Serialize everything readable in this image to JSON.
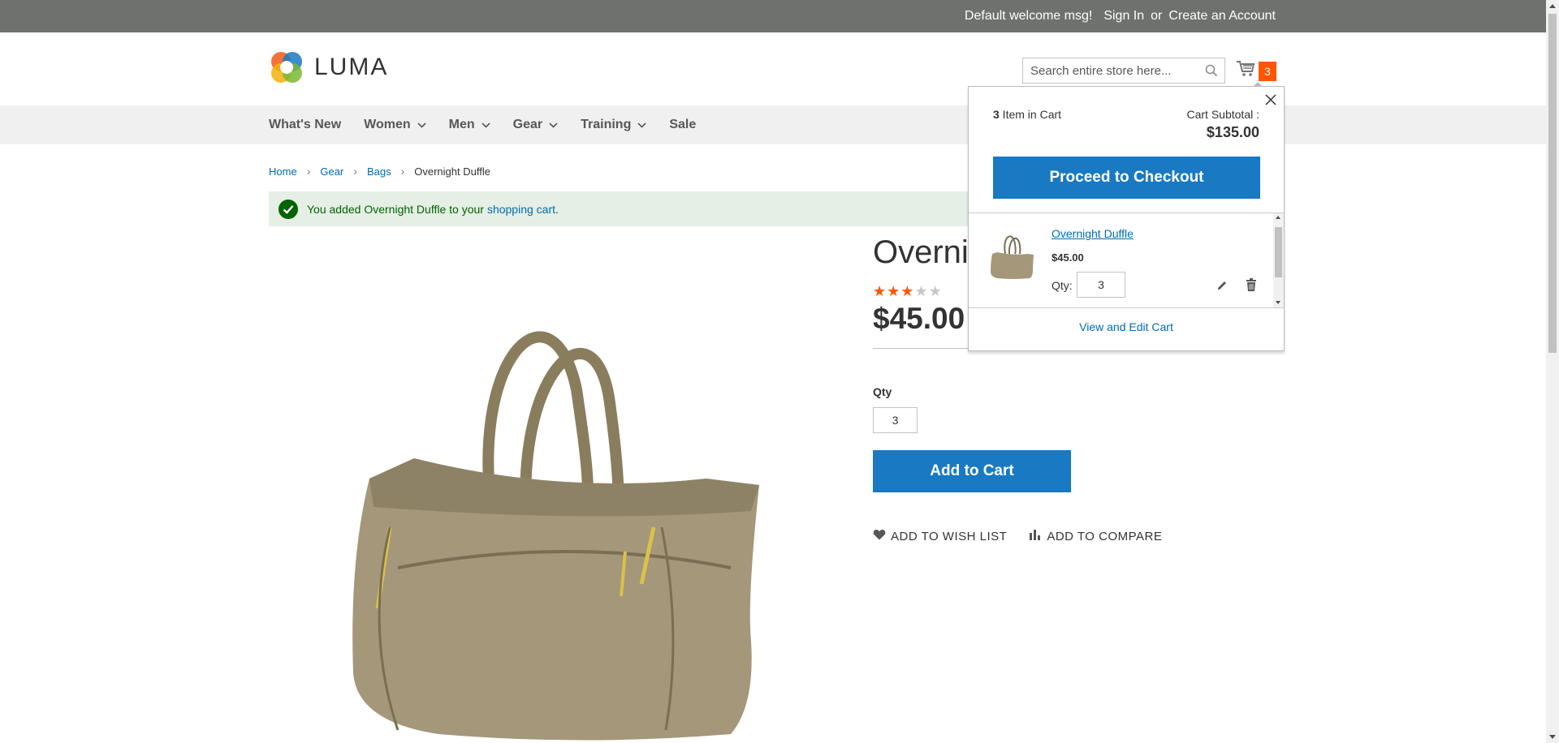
{
  "topbar": {
    "welcome": "Default welcome msg!",
    "sign_in": "Sign In",
    "or": "or",
    "create_account": "Create an Account"
  },
  "header": {
    "logo_text": "LUMA",
    "search_placeholder": "Search entire store here...",
    "cart_count": "3"
  },
  "nav": {
    "items": [
      {
        "label": "What's New",
        "has_dropdown": false
      },
      {
        "label": "Women",
        "has_dropdown": true
      },
      {
        "label": "Men",
        "has_dropdown": true
      },
      {
        "label": "Gear",
        "has_dropdown": true
      },
      {
        "label": "Training",
        "has_dropdown": true
      },
      {
        "label": "Sale",
        "has_dropdown": false
      }
    ]
  },
  "breadcrumbs": {
    "home": "Home",
    "gear": "Gear",
    "bags": "Bags",
    "current": "Overnight Duffle"
  },
  "message": {
    "text": "You added Overnight Duffle to your ",
    "link": "shopping cart",
    "end": "."
  },
  "product": {
    "title": "Overnight Duffle",
    "rating": 3,
    "rating_max": 5,
    "price": "$45.00",
    "qty_label": "Qty",
    "qty_value": "3",
    "add_to_cart": "Add to Cart",
    "wish_list": "ADD TO WISH LIST",
    "compare": "ADD TO COMPARE"
  },
  "minicart": {
    "count": "3",
    "count_suffix": " Item in Cart",
    "subtotal_label": "Cart Subtotal :",
    "subtotal": "$135.00",
    "checkout": "Proceed to Checkout",
    "item_name": "Overnight Duffle",
    "item_price": "$45.00",
    "qty_label": "Qty:",
    "qty_value": "3",
    "view_cart": "View and Edit Cart"
  },
  "colors": {
    "primary": "#1979c3",
    "accent": "#ff5501",
    "link": "#006bb4",
    "success_bg": "#e5efe5"
  }
}
